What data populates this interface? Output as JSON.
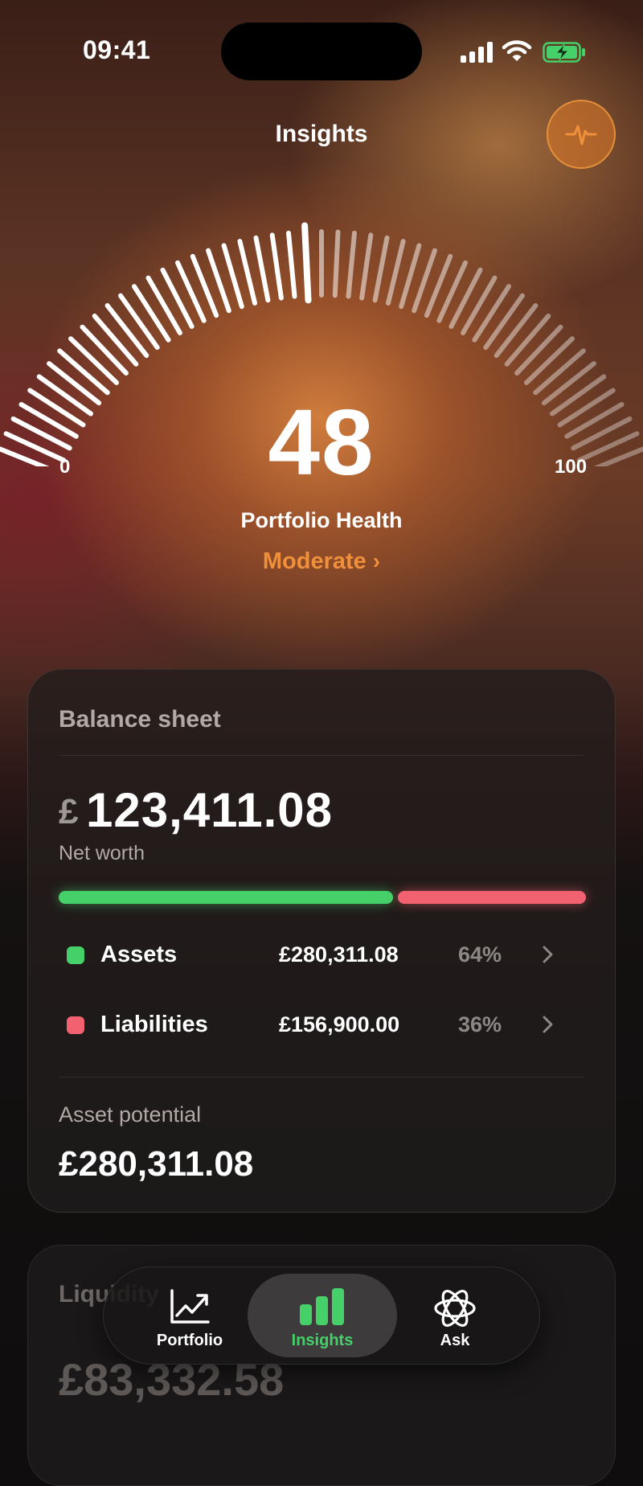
{
  "status_bar": {
    "time": "09:41"
  },
  "header": {
    "title": "Insights",
    "action_icon": "pulse-icon"
  },
  "gauge": {
    "value": 48,
    "min_label": "0",
    "max_label": "100",
    "score": "48",
    "label": "Portfolio Health",
    "status": "Moderate",
    "status_color": "#f0903a"
  },
  "balance_sheet": {
    "title": "Balance sheet",
    "currency": "£",
    "net_worth": "123,411.08",
    "net_worth_label": "Net worth",
    "assets_share": 0.64,
    "rows": [
      {
        "name": "Assets",
        "amount": "£280,311.08",
        "percent": "64%",
        "color": "#46d069"
      },
      {
        "name": "Liabilities",
        "amount": "£156,900.00",
        "percent": "36%",
        "color": "#f2616f"
      }
    ],
    "asset_potential_label": "Asset potential",
    "asset_potential_value": "£280,311.08"
  },
  "liquidity_card": {
    "title": "Liquidity",
    "value": "£83,332.58"
  },
  "tab_bar": {
    "active": "Insights",
    "tabs": [
      {
        "label": "Portfolio",
        "icon": "chart-line-icon"
      },
      {
        "label": "Insights",
        "icon": "bar-chart-icon"
      },
      {
        "label": "Ask",
        "icon": "atom-icon"
      }
    ]
  }
}
